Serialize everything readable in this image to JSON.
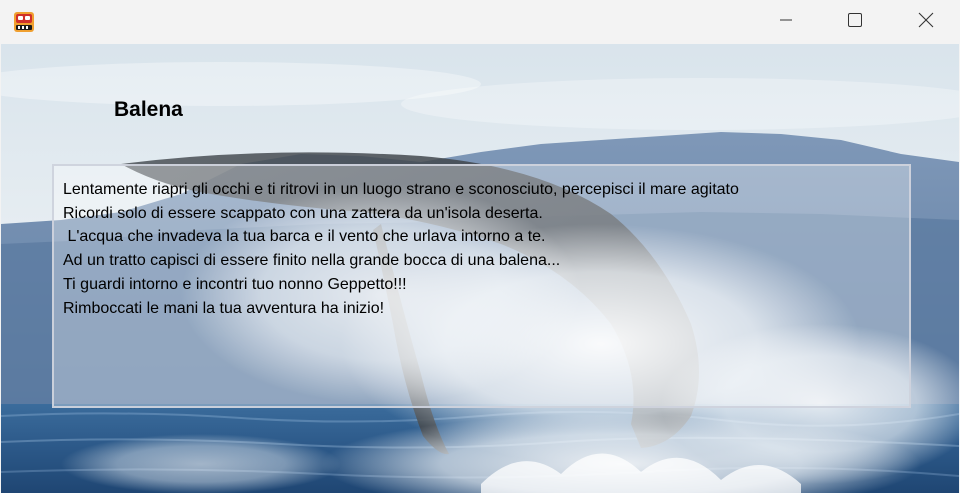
{
  "window": {
    "title": "",
    "app_icon": "game-app-icon",
    "controls": {
      "minimize_icon": "minimize-icon",
      "maximize_icon": "maximize-icon",
      "close_icon": "close-icon"
    }
  },
  "scene": {
    "title": "Balena",
    "background": "whale-breaching-ocean-image",
    "lines": [
      "Lentamente riapri gli occhi e ti ritrovi in un luogo strano e sconosciuto, percepisci il mare agitato",
      "Ricordi solo di essere scappato con una zattera da un'isola deserta.",
      " L'acqua che invadeva la tua barca e il vento che urlava intorno a te.",
      "Ad un tratto capisci di essere finito nella grande bocca di una balena...",
      "Ti guardi intorno e incontri tuo nonno Geppetto!!!",
      "Rimboccati le mani la tua avventura ha inizio!"
    ]
  },
  "colors": {
    "sky": "#e6eef3",
    "mountains": "#6d89ad",
    "sea": "#2f5f93",
    "whale": "#3a3f44",
    "spray": "#ffffff"
  }
}
